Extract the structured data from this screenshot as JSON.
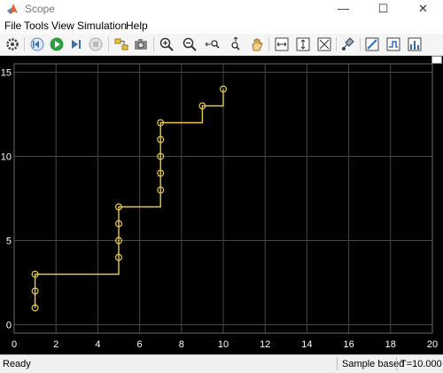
{
  "window": {
    "title": "Scope"
  },
  "menu": [
    "File",
    "Tools",
    "View",
    "Simulation",
    "Help"
  ],
  "toolbar_icons": [
    "gear-icon",
    "step-back-icon",
    "run-icon",
    "step-forward-icon",
    "stop-icon",
    "highlight-block-icon",
    "snapshot-icon",
    "zoom-in-icon",
    "zoom-out-icon",
    "zoom-x-icon",
    "zoom-y-icon",
    "pan-icon",
    "scale-xy-icon",
    "scale-x-icon",
    "scale-y-icon",
    "signal-selector-icon",
    "cursor-measure-icon",
    "trigger-icon",
    "peak-finder-icon"
  ],
  "status": {
    "ready": "Ready",
    "mode": "Sample based",
    "time": "T=10.000"
  },
  "colors": {
    "plot_bg": "#000000",
    "grid": "#464646",
    "trace": "#e6c84a",
    "axis_text": "#ffffff"
  },
  "chart_data": {
    "type": "line",
    "step": true,
    "markers": "circle",
    "x": [
      1,
      1,
      1,
      5,
      5,
      5,
      5,
      7,
      7,
      7,
      7,
      7,
      9,
      10
    ],
    "y": [
      1,
      2,
      3,
      4,
      5,
      6,
      7,
      8,
      9,
      10,
      11,
      12,
      13,
      14
    ],
    "xlim": [
      0,
      20
    ],
    "ylim": [
      -0.5,
      15.5
    ],
    "xticks": [
      0,
      2,
      4,
      6,
      8,
      10,
      12,
      14,
      16,
      18,
      20
    ],
    "yticks": [
      0,
      5,
      10,
      15
    ],
    "grid": true,
    "title": "",
    "xlabel": "",
    "ylabel": ""
  }
}
